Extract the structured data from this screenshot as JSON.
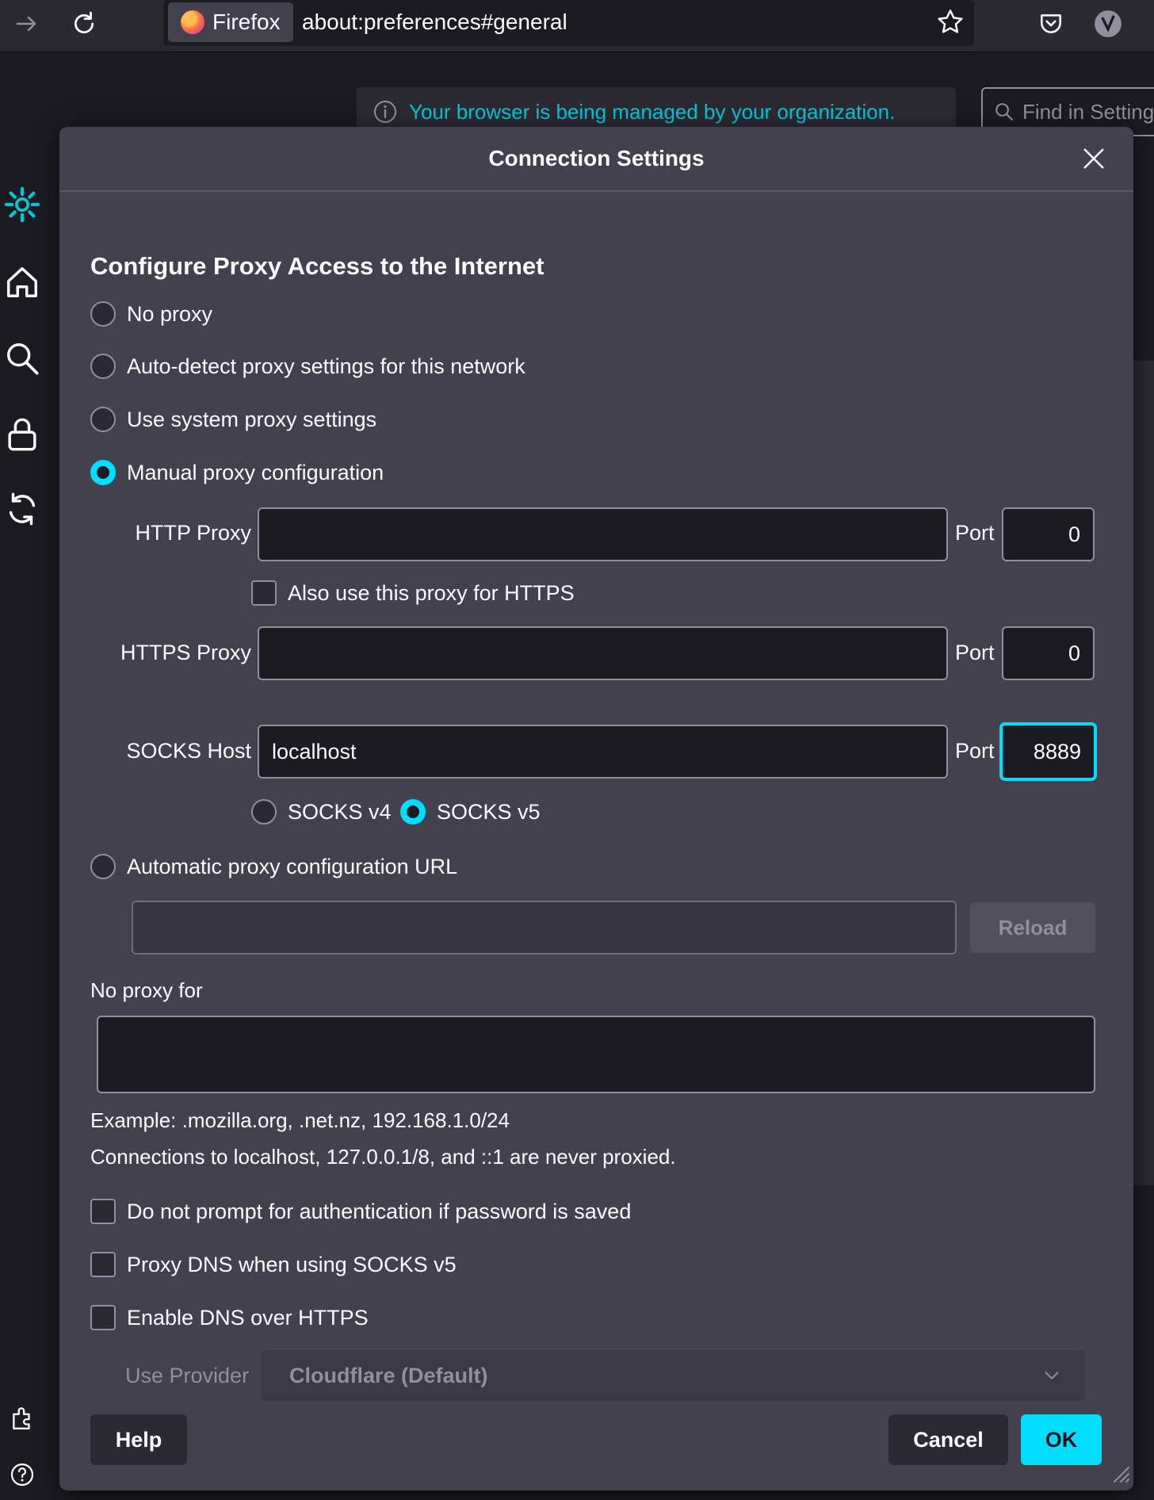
{
  "toolbar": {
    "identity_label": "Firefox",
    "url": "about:preferences#general"
  },
  "background": {
    "managed_notice": "Your browser is being managed by your organization.",
    "find_placeholder": "Find in Settings"
  },
  "dialog": {
    "title": "Connection Settings",
    "section_title": "Configure Proxy Access to the Internet",
    "options": {
      "no_proxy": "No proxy",
      "auto_detect": "Auto-detect proxy settings for this network",
      "system": "Use system proxy settings",
      "manual": "Manual proxy configuration",
      "auto_url": "Automatic proxy configuration URL"
    },
    "selected_option": "manual",
    "http_proxy": {
      "label": "HTTP Proxy",
      "value": "",
      "port_label": "Port",
      "port": "0"
    },
    "also_https": "Also use this proxy for HTTPS",
    "https_proxy": {
      "label": "HTTPS Proxy",
      "value": "",
      "port_label": "Port",
      "port": "0"
    },
    "socks": {
      "label": "SOCKS Host",
      "value": "localhost",
      "port_label": "Port",
      "port": "8889"
    },
    "socks_versions": {
      "v4": "SOCKS v4",
      "v5": "SOCKS v5",
      "selected": "v5"
    },
    "auto_url_value": "",
    "reload_label": "Reload",
    "no_proxy_for": {
      "label": "No proxy for",
      "value": ""
    },
    "example_text": "Example: .mozilla.org, .net.nz, 192.168.1.0/24",
    "localhost_text": "Connections to localhost, 127.0.0.1/8, and ::1 are never proxied.",
    "checkboxes": {
      "no_prompt": "Do not prompt for authentication if password is saved",
      "proxy_dns": "Proxy DNS when using SOCKS v5",
      "dns_https": "Enable DNS over HTTPS"
    },
    "provider": {
      "label": "Use Provider",
      "value": "Cloudflare (Default)"
    },
    "buttons": {
      "help": "Help",
      "cancel": "Cancel",
      "ok": "OK"
    }
  },
  "colors": {
    "accent": "#00ddff",
    "dialog_bg": "#42414d",
    "page_bg": "#1c1b22",
    "link": "#00c8d7"
  }
}
